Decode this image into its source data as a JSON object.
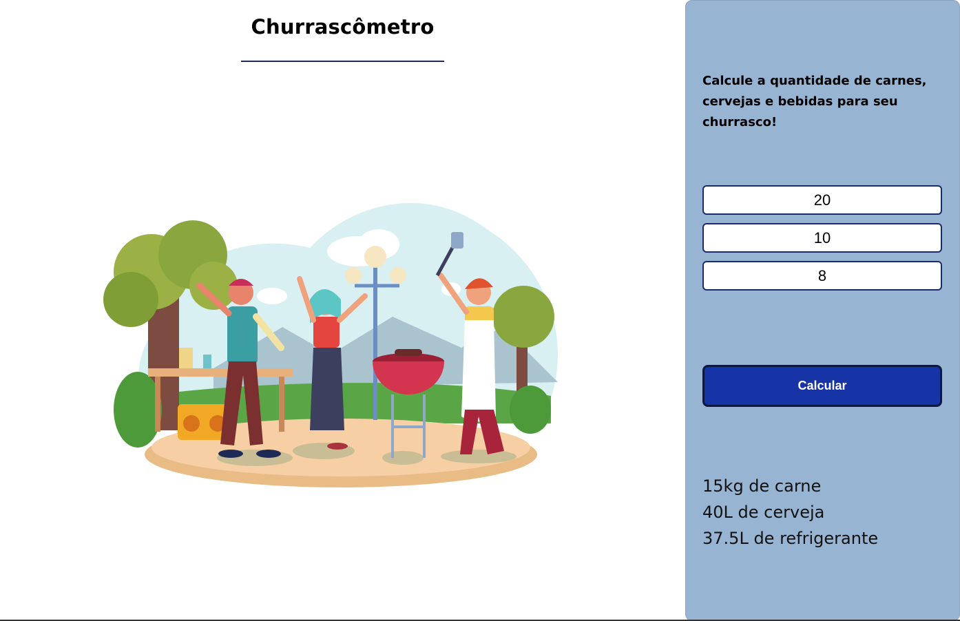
{
  "header": {
    "title": "Churrascômetro"
  },
  "panel": {
    "intro": "Calcule a quantidade de carnes, cervejas e bebidas para seu churrasco!",
    "inputs": [
      {
        "value": "20"
      },
      {
        "value": "10"
      },
      {
        "value": "8"
      }
    ],
    "button_label": "Calcular",
    "results": [
      "15kg de carne",
      "40L de cerveja",
      "37.5L de refrigerante"
    ]
  },
  "colors": {
    "panel_bg": "#97b4d3",
    "button_bg": "#1734a6",
    "accent_border": "#1b2a6b"
  }
}
